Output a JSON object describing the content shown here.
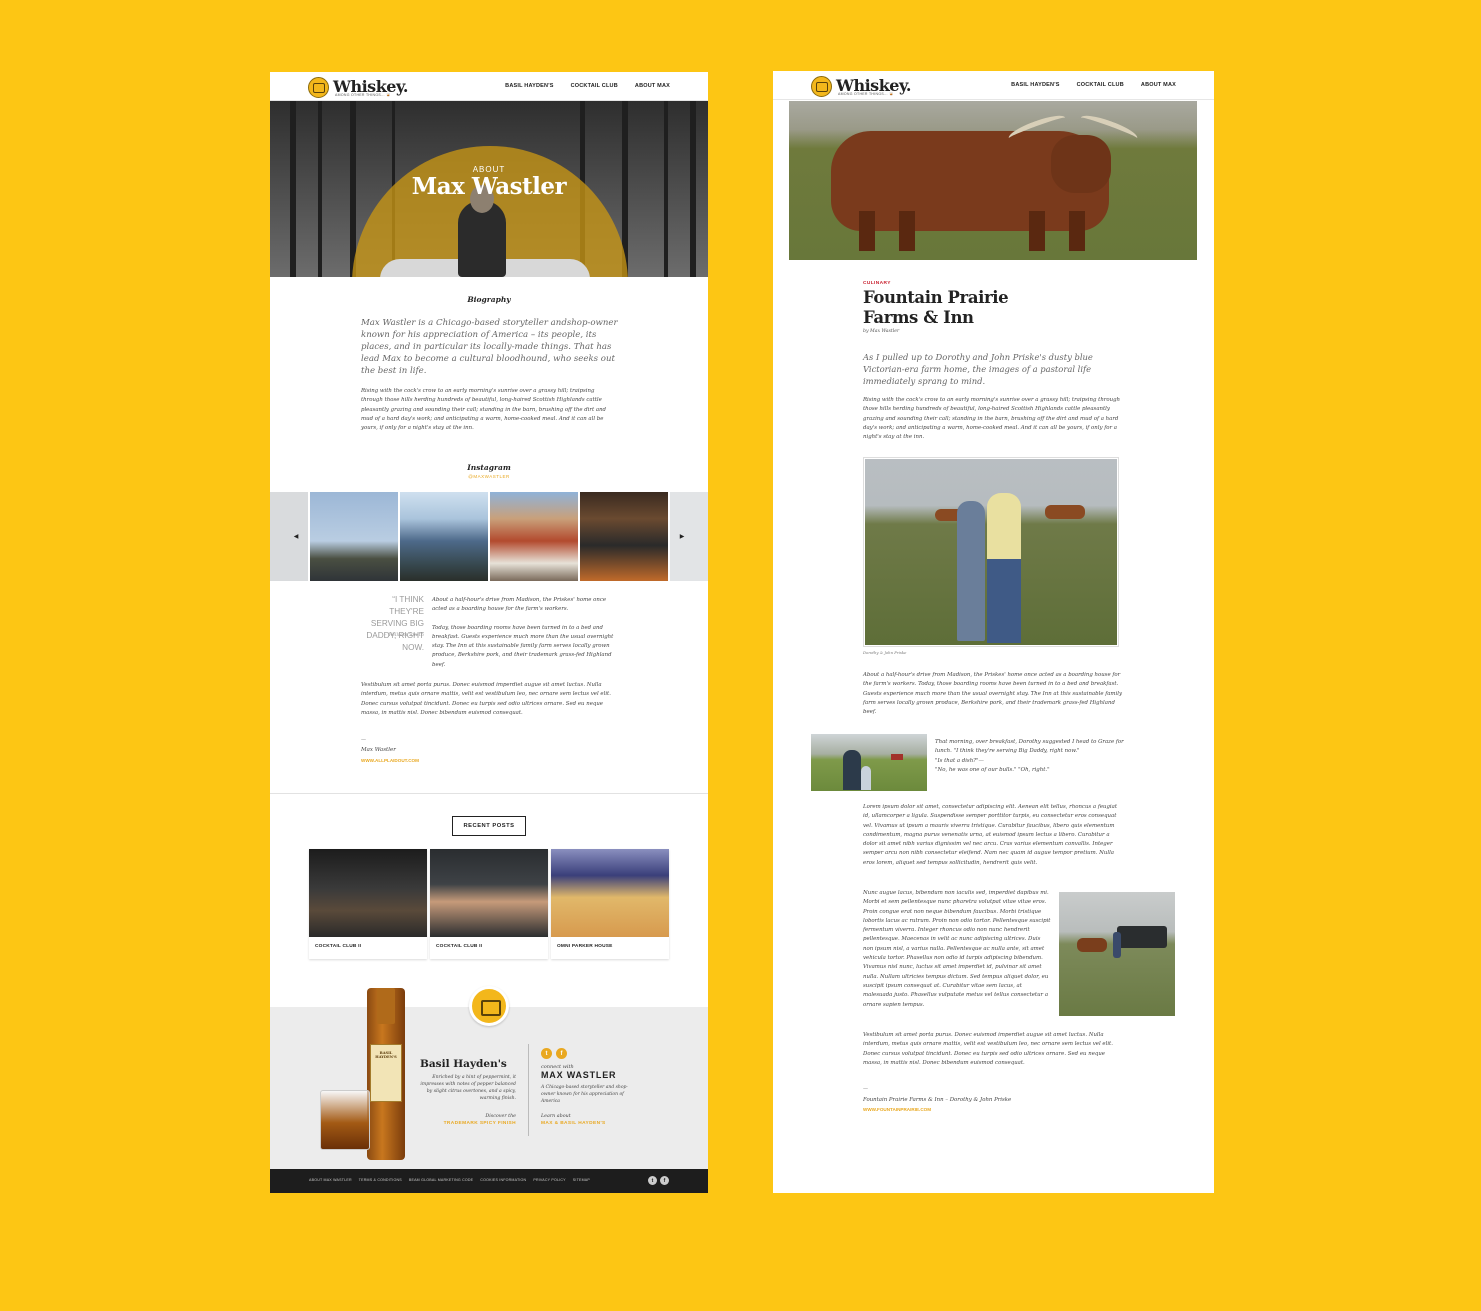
{
  "brand": {
    "logo_text": "Whiskey.",
    "tagline": "AMONG OTHER THINGS... 🥃",
    "accent_color": "#FDC614",
    "link_color": "#E9A820"
  },
  "nav": {
    "items": [
      "BASIL HAYDEN'S",
      "COCKTAIL CLUB",
      "ABOUT MAX"
    ]
  },
  "left_page": {
    "hero": {
      "eyebrow": "ABOUT",
      "title": "Max Wastler"
    },
    "biography": {
      "heading": "Biography",
      "lead": "Max Wastler is a Chicago-based storyteller andshop-owner known for his appreciation of America – its people, its places, and in particular its locally-made things. That has lead Max to become a cultural bloodhound, who seeks out the best in life.",
      "body": "Rising with the cock's crow to an early morning's sunrise over a grassy hill; traipsing through those hills herding hundreds of beautiful, long-haired Scottish Highlands cattle pleasantly grazing and sounding their call; standing in the barn, brushing off the dirt and mud of a hard day's work; and anticipating a warm, home-cooked meal. And it can all be yours, if only for a night's stay at the inn."
    },
    "instagram": {
      "heading": "Instagram",
      "handle": "@MAXWASTLER"
    },
    "pull_quote": {
      "text": "“I THINK THEY'RE SERVING BIG DADDY, RIGHT NOW.",
      "author": "– William Smith"
    },
    "story": {
      "p1": "About a half-hour's drive from Madison, the Priskes' home once acted as a boarding house for the farm's workers.",
      "p2": "Today, those boarding rooms have been turned in to a bed and breakfast. Guests experience much more than the usual overnight stay. The Inn at this sustainable family farm serves locally grown produce, Berkshire pork, and their trademark grass-fed Highland beef.",
      "p3": "Vestibulum sit amet porta purus. Donec euismod imperdiet augue sit amet luctus. Nulla interdum, metus quis ornare mattis, velit est vestibulum leo, nec ornare sem lectus vel elit. Donec cursus volutpat tincidunt. Donec eu turpis sed odio ultrices ornare. Sed eu neque massa, in mattis nisl. Donec bibendum euismod consequat."
    },
    "signature": {
      "dash": "—",
      "name": "Max Wastler",
      "url": "WWW.ALLPLAIDOUT.COM"
    },
    "recent_posts": {
      "button": "RECENT POSTS",
      "posts": [
        {
          "label": "COCKTAIL CLUB II"
        },
        {
          "label": "COCKTAIL CLUB II"
        },
        {
          "label": "OMNI PARKER HOUSE"
        }
      ]
    },
    "promo": {
      "bottle_label": "BASIL HAYDEN'S",
      "title": "Basil Hayden's",
      "description": "Enriched by a hint of peppermint, it impresses with notes of pepper balanced by slight citrus overtones, and a spicy, warming finish.",
      "discover": "Discover the",
      "finish_link": "TRADEMARK SPICY FINISH",
      "connect": "connect with",
      "connect_name": "MAX WASTLER",
      "connect_desc": "A Chicago-based storyteller and shop-owner known for his appreciation of America",
      "learn": "Learn about",
      "learn_link": "MAX & BASIL HAYDEN'S"
    },
    "footer": {
      "links": [
        "ABOUT MAX WASTLER",
        "TERMS & CONDITIONS",
        "BEAM GLOBAL MARKETING CODE",
        "COOKIES INFORMATION",
        "PRIVACY POLICY",
        "SITEMAP"
      ]
    }
  },
  "right_page": {
    "category": "CULINARY",
    "title": "Fountain Prairie Farms & Inn",
    "byline": "by Max Wastler",
    "lead": "As I pulled up to Dorothy and John Priske's dusty blue Victorian-era farm home, the images of a pastoral life immediately sprang to mind.",
    "body1": "Rising with the cock's crow to an early morning's sunrise over a grassy hill; traipsing through those hills herding hundreds of beautiful, long-haired Scottish Highlands cattle pleasantly grazing and sounding their call; standing in the barn, brushing off the dirt and mud of a hard day's work; and anticipating a warm, home-cooked meal. And it can all be yours, if only for a night's stay at the inn.",
    "photo_caption": "Dorothy & John Priske",
    "body2": "About a half-hour's drive from Madison, the Priskes' home once acted as a boarding house for the farm's workers. Today, those boarding rooms have been turned in to a bed and breakfast. Guests experience much more than the usual overnight stay. The Inn at this sustainable family farm serves locally grown produce, Berkshire pork, and their trademark grass-fed Highland beef.",
    "dialogue": {
      "line1": "That morning, over breakfast, Dorothy suggested I head to Graze for lunch. \"I think they're serving Big Daddy, right now.\"",
      "line2": "\"Is that a dish?\"—",
      "line3": "\"No, he was one of our bulls.\" \"Oh, right.\""
    },
    "lorem1": "Lorem ipsum dolor sit amet, consectetur adipiscing elit. Aenean elit tellus, rhoncus a feugiat id, ullamcorper a ligula. Suspendisse semper porttitor turpis, eu consectetur eros consequat vel. Vivamus ut ipsum a mauris viverra tristique. Curabitur faucibus, libero quis elementum condimentum, magna purus venenatis urna, at euismod ipsum lectus a libero. Curabitur a dolor sit amet nibh varius dignissim vel nec arcu. Cras varius elementum convallis. Integer semper arcu non nibh consectetur eleifend. Nam nec quam id augue tempor pretium. Nulla eros lorem, aliquet sed tempus sollicitudin, hendrerit quis velit.",
    "lorem2": "Nunc augue lacus, bibendum non iaculis sed, imperdiet dapibus mi. Morbi et sem pellentesque nunc pharetra volutpat vitae vitae eros. Proin congue erat non neque bibendum faucibus. Morbi tristique lobortis lacus ac rutrum. Proin non odio tortor. Pellentesque suscipit fermentum viverra. Integer rhoncus odio non nunc hendrerit pellentesque. Maecenas in velit ac nunc adipiscing ultrices. Duis non ipsum nisl, a varius nulla. Pellentesque ac nulla ante, sit amet vehicula tortor. Phasellus non odio id turpis adipiscing bibendum. Vivamus nisl nunc, luctus sit amet imperdiet id, pulvinar sit amet nulla. Nullam ultricies tempus dictum. Sed tempus aliquet dolor, eu suscipit ipsum consequat at. Curabitur vitae sem lacus, at malesuada justo. Phasellus vulputate metus vel tellus consectetur a ornare sapien tempus.",
    "lorem3": "Vestibulum sit amet porta purus. Donec euismod imperdiet augue sit amet luctus. Nulla interdum, metus quis ornare mattis, velit est vestibulum leo, nec ornare sem lectus vel elit. Donec cursus volutpat tincidunt. Donec eu turpis sed odio ultrices ornare. Sed eu neque massa, in mattis nisl. Donec bibendum euismod consequat.",
    "signature": {
      "dash": "—",
      "text": "Fountain Prairie Farms & Inn – Dorothy & John Priske",
      "url": "WWW.FOUNTAINPRAIRIE.COM"
    }
  }
}
